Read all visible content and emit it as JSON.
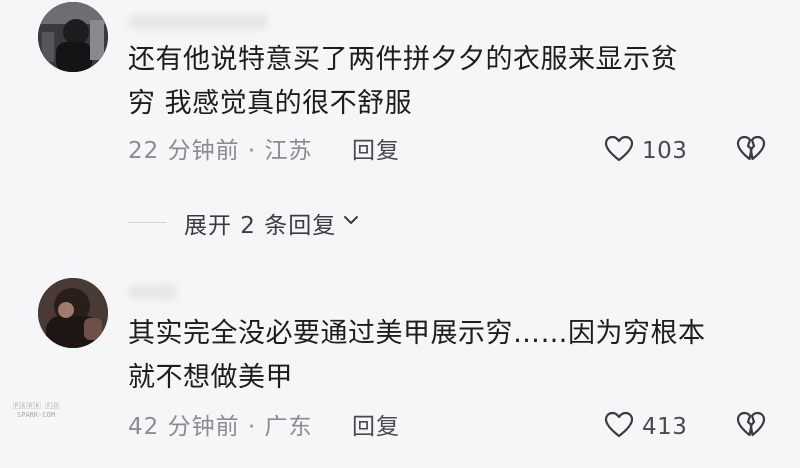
{
  "comments": [
    {
      "text": "还有他说特意买了两件拼夕夕的衣服来显示贫\n穷 我感觉真的很不舒服",
      "time_location": "22 分钟前 · 江苏",
      "reply_label": "回复",
      "like_count": "103",
      "like_icon": "heart-outline-icon",
      "dislike_icon": "broken-heart-icon"
    },
    {
      "text": "其实完全没必要通过美甲展示穷……因为穷根本\n就不想做美甲",
      "time_location": "42 分钟前 · 广东",
      "reply_label": "回复",
      "like_count": "413",
      "like_icon": "heart-outline-icon",
      "dislike_icon": "broken-heart-icon"
    }
  ],
  "expand_replies": {
    "label": "展开 2 条回复",
    "icon": "chevron-down-icon"
  },
  "watermark": {
    "line1": "🄿🄰🅁🄺 🄵🄾",
    "line2": "SPARK-COM"
  },
  "colors": {
    "background": "#f6f6f8",
    "text_primary": "#1d1d1f",
    "text_meta": "#8c8c90"
  }
}
